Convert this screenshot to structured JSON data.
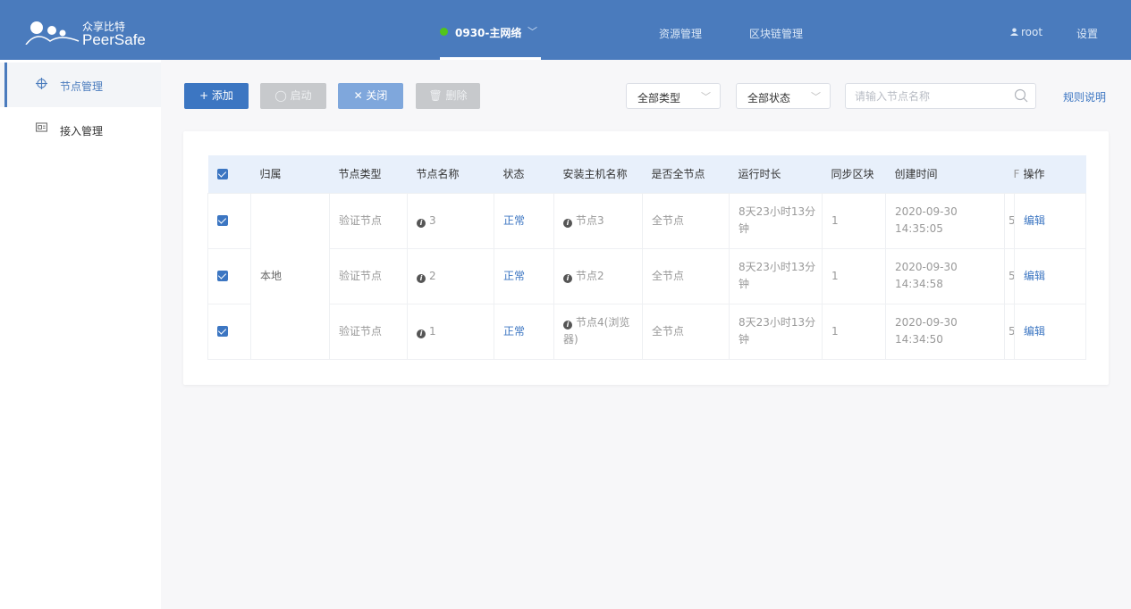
{
  "header": {
    "brand_cn": "众享比特",
    "brand_en": "PeerSafe",
    "network": "0930-主网络",
    "nav": [
      "资源管理",
      "区块链管理"
    ],
    "user": "root",
    "settings": "设置"
  },
  "sidebar": {
    "items": [
      {
        "label": "节点管理",
        "icon": "crosshair-icon",
        "active": true
      },
      {
        "label": "接入管理",
        "icon": "access-card-icon",
        "active": false
      }
    ]
  },
  "toolbar": {
    "add": "+ 添加",
    "start": "◯ 启动",
    "close": "✕ 关闭",
    "delete": "🗑 删除",
    "type_select": "全部类型",
    "status_select": "全部状态",
    "search_placeholder": "请输入节点名称",
    "rules": "规则说明"
  },
  "table": {
    "columns": [
      "归属",
      "节点类型",
      "节点名称",
      "状态",
      "安装主机名称",
      "是否全节点",
      "运行时长",
      "同步区块",
      "创建时间",
      "F",
      "操作"
    ],
    "owner": "本地",
    "rows": [
      {
        "type": "验证节点",
        "name": "3",
        "status": "正常",
        "host": "节点3",
        "full": "全节点",
        "uptime": "8天23小时13分钟",
        "sync": "1",
        "created": "2020-09-30 14:35:05",
        "f": "5",
        "action": "编辑"
      },
      {
        "type": "验证节点",
        "name": "2",
        "status": "正常",
        "host": "节点2",
        "full": "全节点",
        "uptime": "8天23小时13分钟",
        "sync": "1",
        "created": "2020-09-30 14:34:58",
        "f": "5",
        "action": "编辑"
      },
      {
        "type": "验证节点",
        "name": "1",
        "status": "正常",
        "host": "节点4(浏览器)",
        "full": "全节点",
        "uptime": "8天23小时13分钟",
        "sync": "1",
        "created": "2020-09-30 14:34:50",
        "f": "5",
        "action": "编辑"
      }
    ]
  },
  "colors": {
    "header": "#4a7bbd",
    "primary": "#3c76c2",
    "online": "#52c41a"
  }
}
